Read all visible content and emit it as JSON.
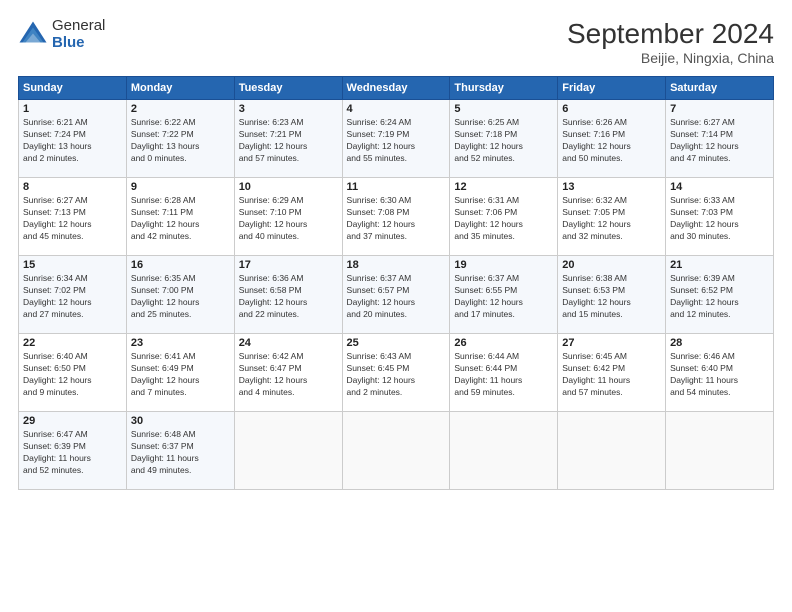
{
  "header": {
    "logo_general": "General",
    "logo_blue": "Blue",
    "month_title": "September 2024",
    "location": "Beijie, Ningxia, China"
  },
  "weekdays": [
    "Sunday",
    "Monday",
    "Tuesday",
    "Wednesday",
    "Thursday",
    "Friday",
    "Saturday"
  ],
  "weeks": [
    [
      {
        "day": "1",
        "info": "Sunrise: 6:21 AM\nSunset: 7:24 PM\nDaylight: 13 hours\nand 2 minutes."
      },
      {
        "day": "2",
        "info": "Sunrise: 6:22 AM\nSunset: 7:22 PM\nDaylight: 13 hours\nand 0 minutes."
      },
      {
        "day": "3",
        "info": "Sunrise: 6:23 AM\nSunset: 7:21 PM\nDaylight: 12 hours\nand 57 minutes."
      },
      {
        "day": "4",
        "info": "Sunrise: 6:24 AM\nSunset: 7:19 PM\nDaylight: 12 hours\nand 55 minutes."
      },
      {
        "day": "5",
        "info": "Sunrise: 6:25 AM\nSunset: 7:18 PM\nDaylight: 12 hours\nand 52 minutes."
      },
      {
        "day": "6",
        "info": "Sunrise: 6:26 AM\nSunset: 7:16 PM\nDaylight: 12 hours\nand 50 minutes."
      },
      {
        "day": "7",
        "info": "Sunrise: 6:27 AM\nSunset: 7:14 PM\nDaylight: 12 hours\nand 47 minutes."
      }
    ],
    [
      {
        "day": "8",
        "info": "Sunrise: 6:27 AM\nSunset: 7:13 PM\nDaylight: 12 hours\nand 45 minutes."
      },
      {
        "day": "9",
        "info": "Sunrise: 6:28 AM\nSunset: 7:11 PM\nDaylight: 12 hours\nand 42 minutes."
      },
      {
        "day": "10",
        "info": "Sunrise: 6:29 AM\nSunset: 7:10 PM\nDaylight: 12 hours\nand 40 minutes."
      },
      {
        "day": "11",
        "info": "Sunrise: 6:30 AM\nSunset: 7:08 PM\nDaylight: 12 hours\nand 37 minutes."
      },
      {
        "day": "12",
        "info": "Sunrise: 6:31 AM\nSunset: 7:06 PM\nDaylight: 12 hours\nand 35 minutes."
      },
      {
        "day": "13",
        "info": "Sunrise: 6:32 AM\nSunset: 7:05 PM\nDaylight: 12 hours\nand 32 minutes."
      },
      {
        "day": "14",
        "info": "Sunrise: 6:33 AM\nSunset: 7:03 PM\nDaylight: 12 hours\nand 30 minutes."
      }
    ],
    [
      {
        "day": "15",
        "info": "Sunrise: 6:34 AM\nSunset: 7:02 PM\nDaylight: 12 hours\nand 27 minutes."
      },
      {
        "day": "16",
        "info": "Sunrise: 6:35 AM\nSunset: 7:00 PM\nDaylight: 12 hours\nand 25 minutes."
      },
      {
        "day": "17",
        "info": "Sunrise: 6:36 AM\nSunset: 6:58 PM\nDaylight: 12 hours\nand 22 minutes."
      },
      {
        "day": "18",
        "info": "Sunrise: 6:37 AM\nSunset: 6:57 PM\nDaylight: 12 hours\nand 20 minutes."
      },
      {
        "day": "19",
        "info": "Sunrise: 6:37 AM\nSunset: 6:55 PM\nDaylight: 12 hours\nand 17 minutes."
      },
      {
        "day": "20",
        "info": "Sunrise: 6:38 AM\nSunset: 6:53 PM\nDaylight: 12 hours\nand 15 minutes."
      },
      {
        "day": "21",
        "info": "Sunrise: 6:39 AM\nSunset: 6:52 PM\nDaylight: 12 hours\nand 12 minutes."
      }
    ],
    [
      {
        "day": "22",
        "info": "Sunrise: 6:40 AM\nSunset: 6:50 PM\nDaylight: 12 hours\nand 9 minutes."
      },
      {
        "day": "23",
        "info": "Sunrise: 6:41 AM\nSunset: 6:49 PM\nDaylight: 12 hours\nand 7 minutes."
      },
      {
        "day": "24",
        "info": "Sunrise: 6:42 AM\nSunset: 6:47 PM\nDaylight: 12 hours\nand 4 minutes."
      },
      {
        "day": "25",
        "info": "Sunrise: 6:43 AM\nSunset: 6:45 PM\nDaylight: 12 hours\nand 2 minutes."
      },
      {
        "day": "26",
        "info": "Sunrise: 6:44 AM\nSunset: 6:44 PM\nDaylight: 11 hours\nand 59 minutes."
      },
      {
        "day": "27",
        "info": "Sunrise: 6:45 AM\nSunset: 6:42 PM\nDaylight: 11 hours\nand 57 minutes."
      },
      {
        "day": "28",
        "info": "Sunrise: 6:46 AM\nSunset: 6:40 PM\nDaylight: 11 hours\nand 54 minutes."
      }
    ],
    [
      {
        "day": "29",
        "info": "Sunrise: 6:47 AM\nSunset: 6:39 PM\nDaylight: 11 hours\nand 52 minutes."
      },
      {
        "day": "30",
        "info": "Sunrise: 6:48 AM\nSunset: 6:37 PM\nDaylight: 11 hours\nand 49 minutes."
      },
      null,
      null,
      null,
      null,
      null
    ]
  ]
}
